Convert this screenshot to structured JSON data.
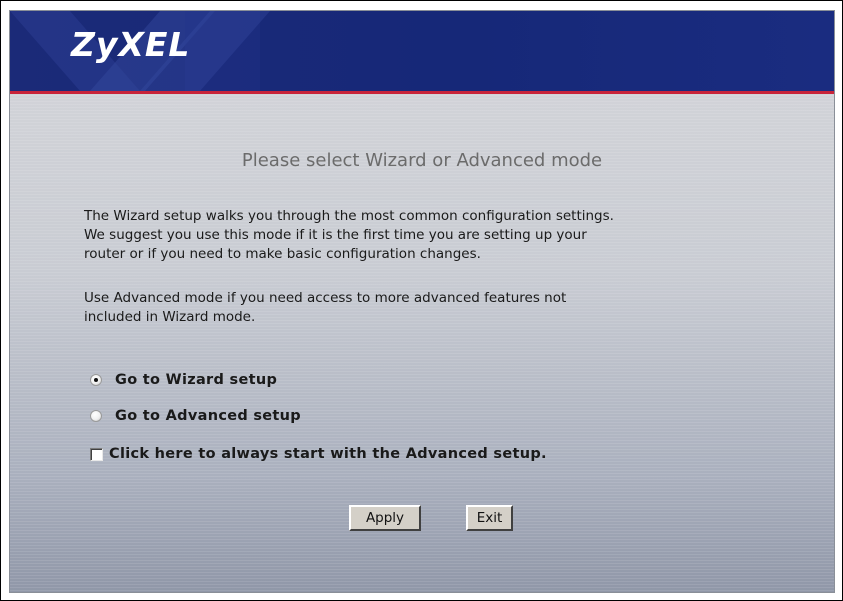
{
  "header": {
    "logo_text": "ZyXEL",
    "colors": {
      "bar": "#1b2a78",
      "accent_line": "#c8233a"
    }
  },
  "main": {
    "title": "Please select Wizard or Advanced mode",
    "paragraph1_lines": [
      "The Wizard setup walks you through the most common configuration settings.",
      "We suggest you use this mode if it is the first time you are setting up your",
      "router or if you need to make basic configuration changes."
    ],
    "paragraph2_lines": [
      "Use Advanced mode if you need access to more advanced features not",
      "included in Wizard mode."
    ],
    "options": {
      "wizard_label": "Go to Wizard setup",
      "wizard_checked": true,
      "advanced_label": "Go to Advanced setup",
      "advanced_checked": false,
      "always_label": "Click here to always start with the Advanced setup.",
      "always_checked": false
    },
    "buttons": {
      "apply_label": "Apply",
      "exit_label": "Exit"
    }
  }
}
